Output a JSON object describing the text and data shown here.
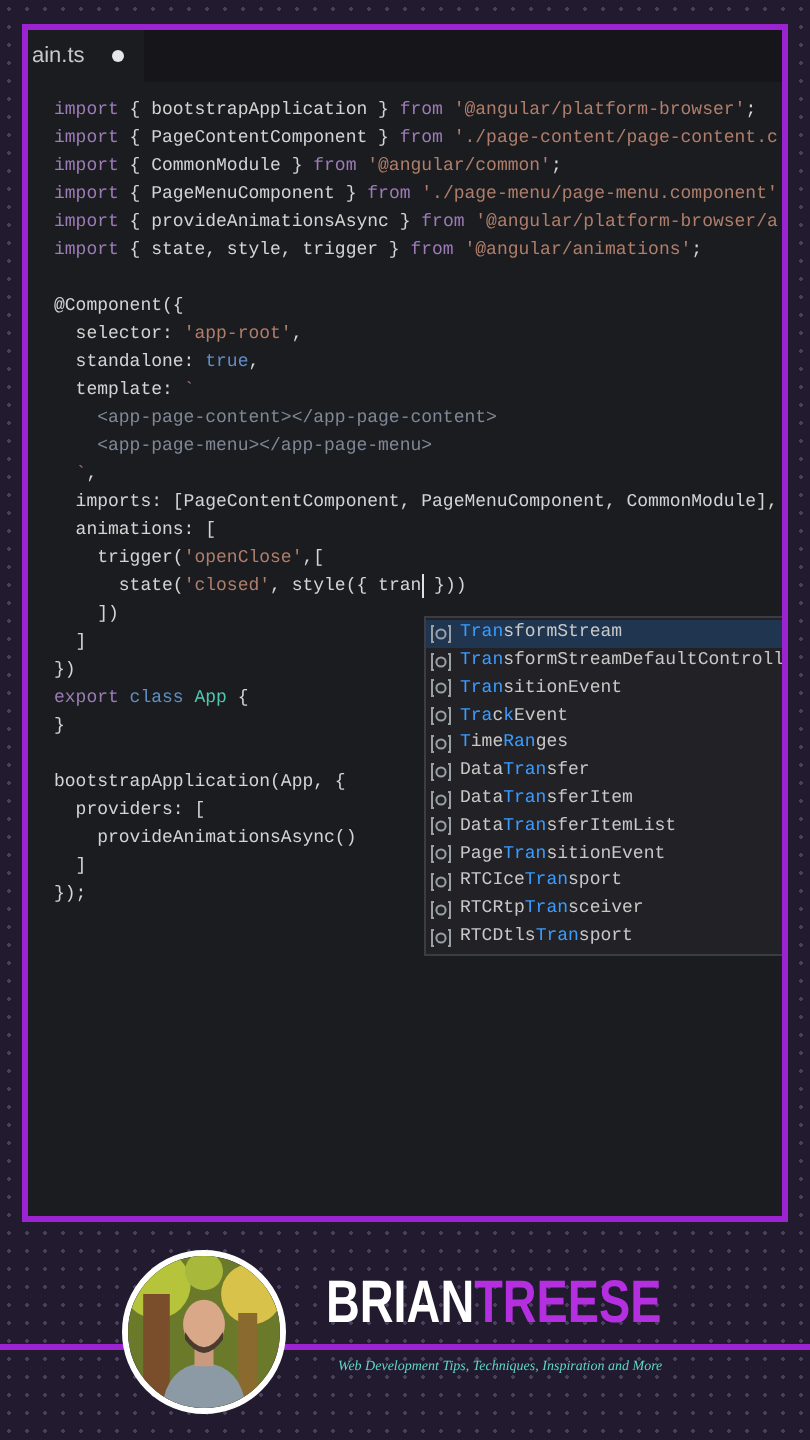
{
  "editor": {
    "tab": {
      "label": "ain.ts",
      "modified": true
    },
    "lines": [
      {
        "kind": "code",
        "tokens": [
          {
            "kind": "kw",
            "text": "import"
          },
          {
            "kind": "id",
            "text": " { bootstrapApplication } "
          },
          {
            "kind": "kw",
            "text": "from"
          },
          {
            "kind": "str",
            "text": " '@angular/platform-browser'"
          },
          {
            "kind": "id",
            "text": ";"
          }
        ]
      },
      {
        "kind": "code",
        "tokens": [
          {
            "kind": "kw",
            "text": "import"
          },
          {
            "kind": "id",
            "text": " { PageContentComponent } "
          },
          {
            "kind": "kw",
            "text": "from"
          },
          {
            "kind": "str",
            "text": " './page-content/page-content.c"
          }
        ]
      },
      {
        "kind": "code",
        "tokens": [
          {
            "kind": "kw",
            "text": "import"
          },
          {
            "kind": "id",
            "text": " { CommonModule } "
          },
          {
            "kind": "kw",
            "text": "from"
          },
          {
            "kind": "str",
            "text": " '@angular/common'"
          },
          {
            "kind": "id",
            "text": ";"
          }
        ]
      },
      {
        "kind": "code",
        "tokens": [
          {
            "kind": "kw",
            "text": "import"
          },
          {
            "kind": "id",
            "text": " { PageMenuComponent } "
          },
          {
            "kind": "kw",
            "text": "from"
          },
          {
            "kind": "str",
            "text": " './page-menu/page-menu.component'"
          }
        ]
      },
      {
        "kind": "code",
        "tokens": [
          {
            "kind": "kw",
            "text": "import"
          },
          {
            "kind": "id",
            "text": " { provideAnimationsAsync } "
          },
          {
            "kind": "kw",
            "text": "from"
          },
          {
            "kind": "str",
            "text": " '@angular/platform-browser/a"
          }
        ]
      },
      {
        "kind": "code",
        "tokens": [
          {
            "kind": "kw",
            "text": "import"
          },
          {
            "kind": "id",
            "text": " { state, style, trigger } "
          },
          {
            "kind": "kw",
            "text": "from"
          },
          {
            "kind": "str",
            "text": " '@angular/animations'"
          },
          {
            "kind": "id",
            "text": ";"
          }
        ]
      },
      {
        "kind": "blank"
      },
      {
        "kind": "code",
        "tokens": [
          {
            "kind": "id",
            "text": "@Component({"
          }
        ]
      },
      {
        "kind": "code",
        "tokens": [
          {
            "kind": "id",
            "text": "  selector: "
          },
          {
            "kind": "str",
            "text": "'app-root'"
          },
          {
            "kind": "id",
            "text": ","
          }
        ]
      },
      {
        "kind": "code",
        "tokens": [
          {
            "kind": "id",
            "text": "  standalone: "
          },
          {
            "kind": "const",
            "text": "true"
          },
          {
            "kind": "id",
            "text": ","
          }
        ]
      },
      {
        "kind": "code",
        "tokens": [
          {
            "kind": "id",
            "text": "  template: "
          },
          {
            "kind": "str",
            "text": "`"
          }
        ]
      },
      {
        "kind": "code",
        "tokens": [
          {
            "kind": "tag",
            "text": "    <app-page-content></app-page-content>"
          }
        ]
      },
      {
        "kind": "code",
        "tokens": [
          {
            "kind": "tag",
            "text": "    <app-page-menu></app-page-menu>"
          }
        ]
      },
      {
        "kind": "code",
        "tokens": [
          {
            "kind": "str",
            "text": "  `"
          },
          {
            "kind": "id",
            "text": ","
          }
        ]
      },
      {
        "kind": "code",
        "tokens": [
          {
            "kind": "id",
            "text": "  imports: [PageContentComponent, PageMenuComponent, CommonModule],"
          }
        ]
      },
      {
        "kind": "code",
        "tokens": [
          {
            "kind": "id",
            "text": "  animations: ["
          }
        ]
      },
      {
        "kind": "code",
        "tokens": [
          {
            "kind": "id",
            "text": "    trigger("
          },
          {
            "kind": "str",
            "text": "'openClose'"
          },
          {
            "kind": "id",
            "text": ",["
          }
        ]
      },
      {
        "kind": "code",
        "tokens": [
          {
            "kind": "id",
            "text": "      state("
          },
          {
            "kind": "str",
            "text": "'closed'"
          },
          {
            "kind": "id",
            "text": ", style({ tran"
          },
          {
            "kind": "cursor"
          },
          {
            "kind": "id",
            "text": " }))"
          }
        ]
      },
      {
        "kind": "code",
        "tokens": [
          {
            "kind": "id",
            "text": "    ])"
          }
        ]
      },
      {
        "kind": "code",
        "tokens": [
          {
            "kind": "id",
            "text": "  ]"
          }
        ]
      },
      {
        "kind": "code",
        "tokens": [
          {
            "kind": "id",
            "text": "})"
          }
        ]
      },
      {
        "kind": "code",
        "tokens": [
          {
            "kind": "kw",
            "text": "export"
          },
          {
            "kind": "const",
            "text": " class"
          },
          {
            "kind": "type",
            "text": " App"
          },
          {
            "kind": "id",
            "text": " {"
          }
        ]
      },
      {
        "kind": "code",
        "tokens": [
          {
            "kind": "id",
            "text": "}"
          }
        ]
      },
      {
        "kind": "blank"
      },
      {
        "kind": "code",
        "tokens": [
          {
            "kind": "id",
            "text": "bootstrapApplication(App, {"
          }
        ]
      },
      {
        "kind": "code",
        "tokens": [
          {
            "kind": "id",
            "text": "  providers: ["
          }
        ]
      },
      {
        "kind": "code",
        "tokens": [
          {
            "kind": "id",
            "text": "    provideAnimationsAsync()"
          }
        ]
      },
      {
        "kind": "code",
        "tokens": [
          {
            "kind": "id",
            "text": "  ]"
          }
        ]
      },
      {
        "kind": "code",
        "tokens": [
          {
            "kind": "id",
            "text": "});"
          }
        ]
      }
    ],
    "suggestions": [
      {
        "selected": true,
        "parts": [
          {
            "match": true,
            "text": "Tran"
          },
          {
            "match": false,
            "text": "sformStream"
          }
        ]
      },
      {
        "selected": false,
        "parts": [
          {
            "match": true,
            "text": "Tran"
          },
          {
            "match": false,
            "text": "sformStreamDefaultControll"
          }
        ]
      },
      {
        "selected": false,
        "parts": [
          {
            "match": true,
            "text": "Tran"
          },
          {
            "match": false,
            "text": "sitionEvent"
          }
        ]
      },
      {
        "selected": false,
        "parts": [
          {
            "match": true,
            "text": "Tra"
          },
          {
            "match": false,
            "text": "c"
          },
          {
            "match": true,
            "text": "k"
          },
          {
            "match": false,
            "text": "Event"
          }
        ]
      },
      {
        "selected": false,
        "parts": [
          {
            "match": true,
            "text": "T"
          },
          {
            "match": false,
            "text": "ime"
          },
          {
            "match": true,
            "text": "Ran"
          },
          {
            "match": false,
            "text": "ges"
          }
        ]
      },
      {
        "selected": false,
        "parts": [
          {
            "match": false,
            "text": "Data"
          },
          {
            "match": true,
            "text": "Tran"
          },
          {
            "match": false,
            "text": "sfer"
          }
        ]
      },
      {
        "selected": false,
        "parts": [
          {
            "match": false,
            "text": "Data"
          },
          {
            "match": true,
            "text": "Tran"
          },
          {
            "match": false,
            "text": "sferItem"
          }
        ]
      },
      {
        "selected": false,
        "parts": [
          {
            "match": false,
            "text": "Data"
          },
          {
            "match": true,
            "text": "Tran"
          },
          {
            "match": false,
            "text": "sferItemList"
          }
        ]
      },
      {
        "selected": false,
        "parts": [
          {
            "match": false,
            "text": "Page"
          },
          {
            "match": true,
            "text": "Tran"
          },
          {
            "match": false,
            "text": "sitionEvent"
          }
        ]
      },
      {
        "selected": false,
        "parts": [
          {
            "match": false,
            "text": "RTCIce"
          },
          {
            "match": true,
            "text": "Tran"
          },
          {
            "match": false,
            "text": "sport"
          }
        ]
      },
      {
        "selected": false,
        "parts": [
          {
            "match": false,
            "text": "RTCRtp"
          },
          {
            "match": true,
            "text": "Tran"
          },
          {
            "match": false,
            "text": "sceiver"
          }
        ]
      },
      {
        "selected": false,
        "parts": [
          {
            "match": false,
            "text": "RTCDtls"
          },
          {
            "match": true,
            "text": "Tran"
          },
          {
            "match": false,
            "text": "sport"
          }
        ]
      }
    ]
  },
  "footer": {
    "brand": {
      "first": "BRIAN",
      "last": "TREESE"
    },
    "tagline": "Web Development Tips, Techniques, Inspiration and More"
  }
}
